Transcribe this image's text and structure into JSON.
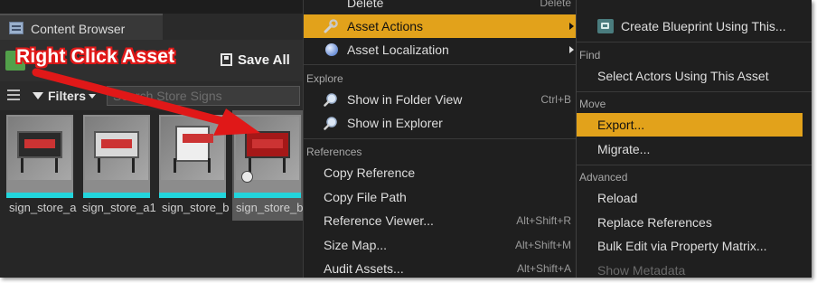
{
  "content_browser": {
    "tab_title": "Content Browser",
    "toolbar": {
      "save_all_label": "Save All"
    },
    "filters_label": "Filters",
    "search_placeholder": "Search Store Signs",
    "assets": [
      {
        "label": "sign_store_a"
      },
      {
        "label": "sign_store_a1"
      },
      {
        "label": "sign_store_b"
      },
      {
        "label": "sign_store_b"
      }
    ]
  },
  "annotation": {
    "text": "Right Click Asset",
    "color": "#e01818"
  },
  "context_menu": {
    "items_top": [
      {
        "label": "Delete",
        "shortcut": "Delete"
      },
      {
        "label": "Asset Actions",
        "highlighted": true,
        "submenu": true,
        "icon": "wrench-icon"
      },
      {
        "label": "Asset Localization",
        "submenu": true,
        "icon": "globe-icon"
      }
    ],
    "explore_header": "Explore",
    "explore_items": [
      {
        "label": "Show in Folder View",
        "shortcut": "Ctrl+B",
        "icon": "magnifier-icon"
      },
      {
        "label": "Show in Explorer",
        "shortcut": "",
        "icon": "magnifier-icon"
      }
    ],
    "references_header": "References",
    "references_items": [
      {
        "label": "Copy Reference",
        "shortcut": ""
      },
      {
        "label": "Copy File Path",
        "shortcut": ""
      },
      {
        "label": "Reference Viewer...",
        "shortcut": "Alt+Shift+R"
      },
      {
        "label": "Size Map...",
        "shortcut": "Alt+Shift+M"
      },
      {
        "label": "Audit Assets...",
        "shortcut": "Alt+Shift+A"
      }
    ]
  },
  "submenu": {
    "top_item": {
      "label": "Create Blueprint Using This...",
      "icon": "blueprint-icon"
    },
    "find_header": "Find",
    "find_items": [
      {
        "label": "Select Actors Using This Asset"
      }
    ],
    "move_header": "Move",
    "move_items": [
      {
        "label": "Export...",
        "highlighted": true
      },
      {
        "label": "Migrate..."
      }
    ],
    "advanced_header": "Advanced",
    "advanced_items": [
      {
        "label": "Reload"
      },
      {
        "label": "Replace References"
      },
      {
        "label": "Bulk Edit via Property Matrix..."
      },
      {
        "label": "Show Metadata",
        "disabled": true
      }
    ]
  },
  "colors": {
    "highlight": "#e2a21b",
    "menu_bg": "#1f1f1f",
    "asset_bar": "#22d5dc"
  }
}
